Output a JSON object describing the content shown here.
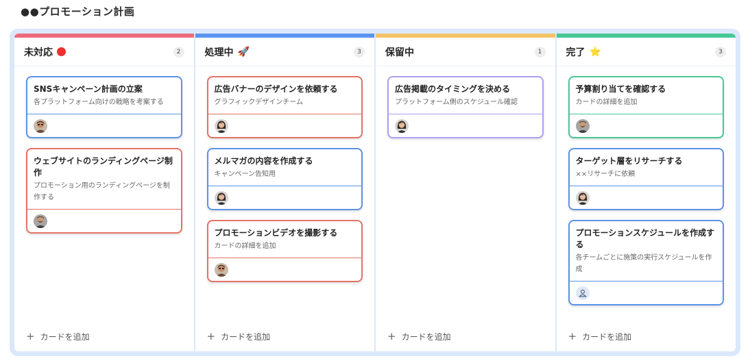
{
  "page_title": "●●プロモーション計画",
  "add_card_label": "カードを追加",
  "columns": [
    {
      "title": "未対応",
      "emoji": "red-dot",
      "count": "2",
      "bar_color": "#ee6b7b",
      "cards": [
        {
          "title": "SNSキャンペーン計画の立案",
          "desc": "各プラットフォーム向けの戦略を考案する",
          "border": "#5b93e6",
          "avatar": "man-sunglasses"
        },
        {
          "title": "ウェブサイトのランディングページ制作",
          "desc": "プロモーション用のランディングページを制作する",
          "border": "#e37365",
          "avatar": "man-beard"
        }
      ]
    },
    {
      "title": "処理中",
      "emoji": "🚀",
      "count": "3",
      "bar_color": "#5b93f0",
      "cards": [
        {
          "title": "広告バナーのデザインを依頼する",
          "desc": "グラフィックデザインチーム",
          "border": "#e37365",
          "avatar": "woman"
        },
        {
          "title": "メルマガの内容を作成する",
          "desc": "キャンペーン告知用",
          "border": "#5b93e6",
          "avatar": "woman"
        },
        {
          "title": "プロモーションビデオを撮影する",
          "desc": "カードの詳細を追加",
          "border": "#e37365",
          "avatar": "man-sunglasses"
        }
      ]
    },
    {
      "title": "保留中",
      "emoji": "",
      "count": "1",
      "bar_color": "#f4c36a",
      "cards": [
        {
          "title": "広告掲載のタイミングを決める",
          "desc": "プラットフォーム側のスケジュール確認",
          "border": "#ad9ff0",
          "avatar": "woman"
        }
      ]
    },
    {
      "title": "完了",
      "emoji": "⭐",
      "count": "3",
      "bar_color": "#47c796",
      "cards": [
        {
          "title": "予算割り当てを確認する",
          "desc": "カードの詳細を追加",
          "border": "#47c796",
          "avatar": "man-beard"
        },
        {
          "title": "ターゲット層をリサーチする",
          "desc": "××リサーチに依頼",
          "border": "#5b93e6",
          "avatar": "woman"
        },
        {
          "title": "プロモーションスケジュールを作成する",
          "desc": "各チームごとに施策の実行スケジュールを作成",
          "border": "#5b93e6",
          "avatar": "empty-user"
        }
      ]
    }
  ]
}
